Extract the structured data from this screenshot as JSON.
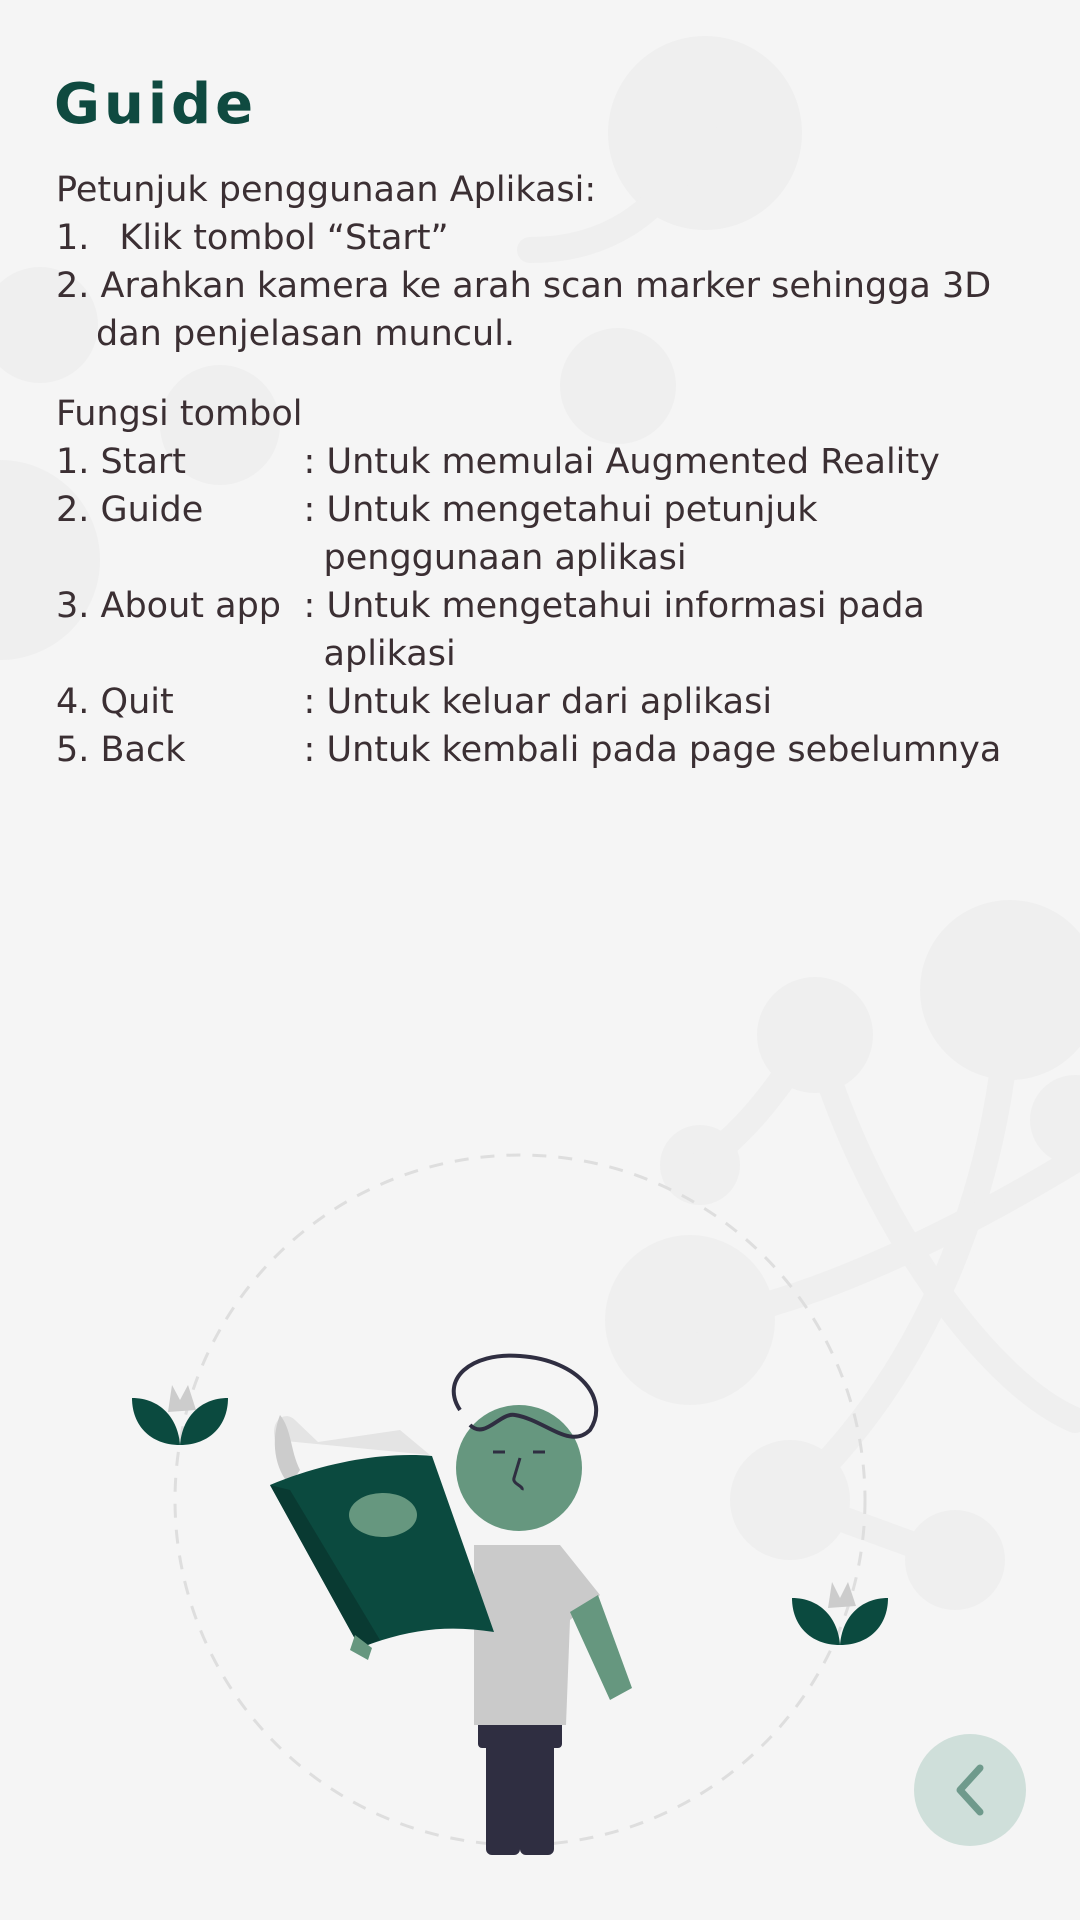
{
  "page": {
    "title": "Guide"
  },
  "instructions": {
    "heading": "Petunjuk penggunaan Aplikasi:",
    "steps": [
      {
        "num": "1.",
        "text": "Klik tombol “Start”"
      },
      {
        "num": "2.",
        "line1": "Arahkan kamera ke arah scan marker sehingga 3D",
        "line2": "dan penjelasan muncul."
      }
    ]
  },
  "button_functions": {
    "heading": "Fungsi tombol",
    "rows": [
      {
        "name": "1. Start",
        "desc1": ": Untuk memulai Augmented Reality"
      },
      {
        "name": "2. Guide",
        "desc1": ": Untuk mengetahui petunjuk",
        "desc2": "penggunaan aplikasi"
      },
      {
        "name": "3. About app",
        "desc1": ": Untuk mengetahui informasi pada",
        "desc2": "aplikasi"
      },
      {
        "name": "4. Quit",
        "desc1": ": Untuk keluar dari aplikasi"
      },
      {
        "name": "5. Back",
        "desc1": ": Untuk kembali pada page sebelumnya"
      }
    ]
  },
  "back_button": {
    "icon": "chevron-left-icon"
  },
  "colors": {
    "background": "#f5f5f5",
    "title": "#0f4a40",
    "text": "#3b2f33",
    "accent_dark_green": "#0b4a3f",
    "accent_light_green": "#66977f",
    "back_button_bg": "#cfdfda",
    "back_button_icon": "#6f9a8c"
  }
}
